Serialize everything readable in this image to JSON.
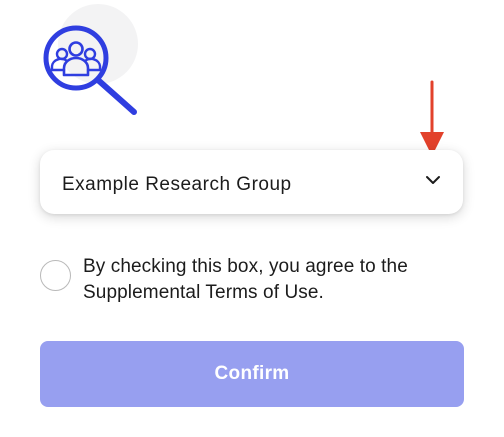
{
  "group_select": {
    "selected_value": "Example Research Group"
  },
  "terms": {
    "checked": false,
    "text": "By checking this box, you agree to the Supplemental Terms of Use."
  },
  "confirm": {
    "label": "Confirm",
    "enabled": false
  },
  "icons": {
    "logo": "group-search-icon",
    "dropdown": "chevron-down-icon",
    "annotation": "arrow-down-icon"
  },
  "colors": {
    "brand": "#2f3ee0",
    "annotation_arrow": "#e2412b",
    "confirm_disabled": "#979ff0"
  }
}
